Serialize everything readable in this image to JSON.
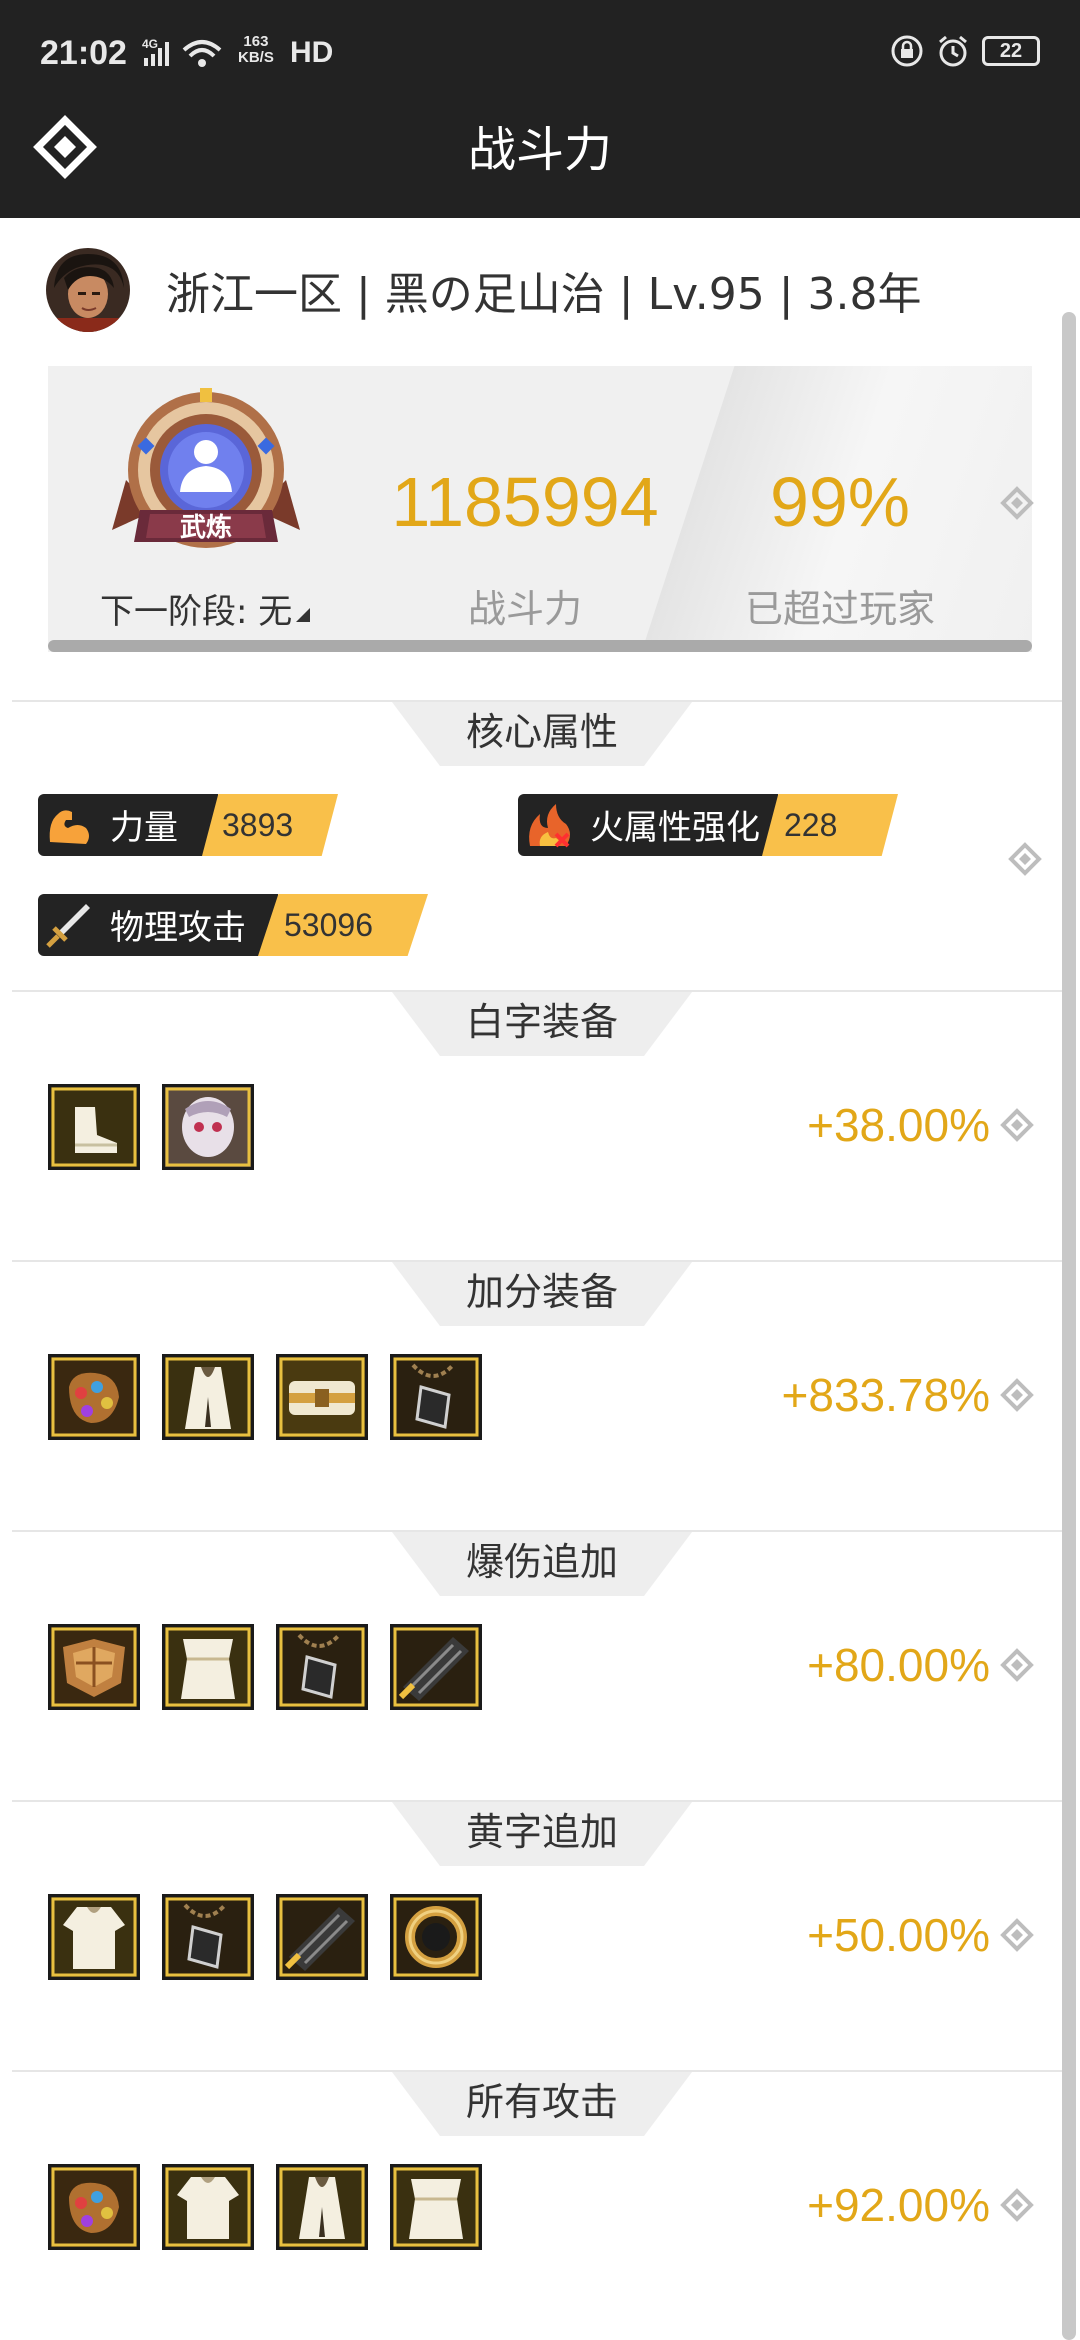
{
  "status_bar": {
    "time": "21:02",
    "network": "4G",
    "speed_value": "163",
    "speed_unit": "KB/S",
    "hd": "HD",
    "battery": "22"
  },
  "header": {
    "title": "战斗力"
  },
  "profile": {
    "line": "浙江一区 | 黑の足山治 | Lv.95 | 3.8年"
  },
  "power": {
    "badge_text": "武炼",
    "next_stage": "下一阶段: 无",
    "value": "1185994",
    "value_label": "战斗力",
    "percent": "99%",
    "percent_label": "已超过玩家"
  },
  "sections": {
    "core": {
      "title": "核心属性",
      "attrs": [
        {
          "label": "力量",
          "value": "3893",
          "icon": "muscle-icon"
        },
        {
          "label": "火属性强化",
          "value": "228",
          "icon": "fire-icon"
        },
        {
          "label": "物理攻击",
          "value": "53096",
          "icon": "sword-icon"
        }
      ]
    },
    "white": {
      "title": "白字装备",
      "percent": "+38.00%"
    },
    "bonus": {
      "title": "加分装备",
      "percent": "+833.78%"
    },
    "crit": {
      "title": "爆伤追加",
      "percent": "+80.00%"
    },
    "yellow": {
      "title": "黄字追加",
      "percent": "+50.00%"
    },
    "all_attack": {
      "title": "所有攻击",
      "percent": "+92.00%"
    }
  },
  "colors": {
    "accent_gold": "#e2a718",
    "header_bg": "#222222",
    "attr_value_bg": "#f9c04a"
  }
}
